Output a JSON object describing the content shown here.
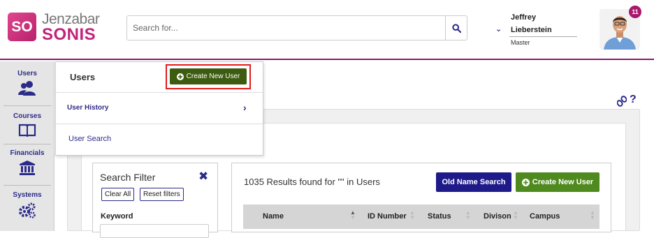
{
  "header": {
    "logo_mark": "SO",
    "logo_top": "Jenzabar",
    "logo_bottom": "SONIS",
    "search_placeholder": "Search for...",
    "user_first": "Jeffrey",
    "user_last": "Lieberstein",
    "user_role": "Master",
    "notification_count": "11"
  },
  "sidebar": {
    "items": [
      {
        "label": "Users",
        "icon": "users-icon"
      },
      {
        "label": "Courses",
        "icon": "book-icon"
      },
      {
        "label": "Financials",
        "icon": "bank-icon"
      },
      {
        "label": "Systems",
        "icon": "gears-icon"
      }
    ]
  },
  "popup": {
    "title": "Users",
    "create_label": "Create New User",
    "items": [
      "User History",
      "User Search"
    ]
  },
  "filter": {
    "title": "Search Filter",
    "clear_all": "Clear All",
    "reset": "Reset filters",
    "keyword_label": "Keyword"
  },
  "results": {
    "summary": "1035 Results found for \"\" in Users",
    "old_name_search": "Old Name Search",
    "create_label": "Create New User",
    "columns": [
      "Name",
      "ID Number",
      "Status",
      "Divison",
      "Campus"
    ]
  },
  "colors": {
    "brand": "#c2227a",
    "navy": "#2b2b8a",
    "green_dark": "#3d5c11",
    "green": "#4f8a1f",
    "highlight": "#e31b1b"
  }
}
